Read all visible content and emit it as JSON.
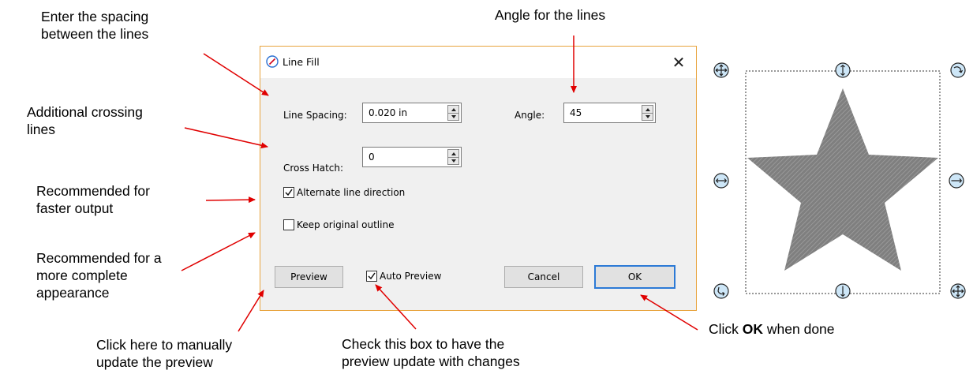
{
  "annotations": {
    "spacing": "Enter the spacing\nbetween the lines",
    "angle": "Angle for the lines",
    "cross": "Additional crossing\nlines",
    "faster": "Recommended for\nfaster output",
    "complete": "Recommended for a\nmore complete\nappearance",
    "manual": "Click here to manually\nupdate the preview",
    "auto": "Check this box to have the\npreview update with changes",
    "ok_prefix": "Click ",
    "ok_bold": "OK",
    "ok_suffix": " when done"
  },
  "dialog": {
    "title": "Line Fill",
    "close_glyph": "✕",
    "line_spacing_label": "Line Spacing:",
    "line_spacing_value": "0.020 in",
    "angle_label": "Angle:",
    "angle_value": "45",
    "cross_hatch_label": "Cross Hatch:",
    "cross_hatch_value": "0",
    "alternate_label": "Alternate line direction",
    "alternate_checked": true,
    "keep_outline_label": "Keep original outline",
    "keep_outline_checked": false,
    "preview_button": "Preview",
    "auto_preview_label": "Auto Preview",
    "auto_preview_checked": true,
    "cancel_button": "Cancel",
    "ok_button": "OK"
  },
  "colors": {
    "arrow": "#e00000",
    "dialog_border": "#e8a33d",
    "default_button_border": "#2c7ad6",
    "star_fill": "#8c8c8c",
    "handle_fill": "#cde6f7"
  }
}
